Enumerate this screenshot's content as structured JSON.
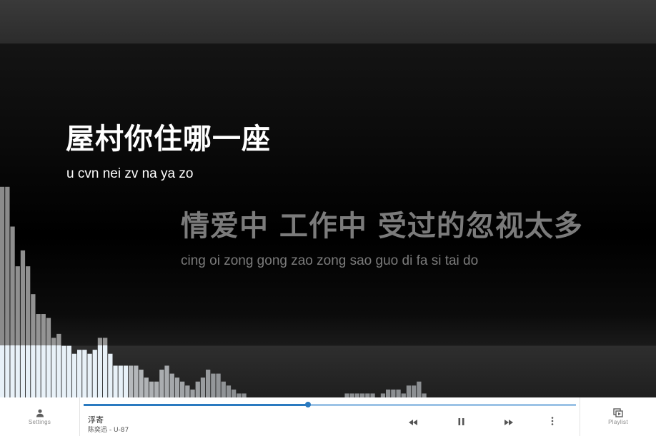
{
  "lyrics": {
    "current": {
      "text": "屋村你住哪一座",
      "romanization": "u cvn nei zv na ya zo"
    },
    "next": {
      "text": "情爱中 工作中 受过的忽视太多",
      "romanization": "cing oi zong gong zao zong sao guo di fa si tai do"
    }
  },
  "visualizer": {
    "levels": [
      0.53,
      0.53,
      0.43,
      0.33,
      0.37,
      0.33,
      0.26,
      0.21,
      0.21,
      0.2,
      0.15,
      0.16,
      0.13,
      0.13,
      0.11,
      0.12,
      0.12,
      0.11,
      0.12,
      0.15,
      0.15,
      0.11,
      0.08,
      0.08,
      0.08,
      0.08,
      0.08,
      0.07,
      0.05,
      0.04,
      0.04,
      0.07,
      0.08,
      0.06,
      0.05,
      0.04,
      0.03,
      0.02,
      0.04,
      0.05,
      0.07,
      0.06,
      0.06,
      0.04,
      0.03,
      0.02,
      0.01,
      0.01,
      0.0,
      0.0,
      0.0,
      0.0,
      0.0,
      0.0,
      0.0,
      0.0,
      0.0,
      0.0,
      0.0,
      0.0,
      0.0,
      0.0,
      0.0,
      0.0,
      0.0,
      0.0,
      0.0,
      0.01,
      0.01,
      0.01,
      0.01,
      0.01,
      0.01,
      0.0,
      0.01,
      0.02,
      0.02,
      0.02,
      0.01,
      0.03,
      0.03,
      0.04,
      0.01,
      0.0,
      0.0,
      0.0,
      0.0,
      0.0
    ],
    "bar_color_light": "#e8f1f8",
    "bar_color_dark": "#8a8a8a"
  },
  "player": {
    "title": "浮寄",
    "artist_album": "陈奕迅 - U-87",
    "progress": 0.456,
    "accent_color": "#2a7ac0",
    "track_color": "#9cc3e6"
  },
  "nav": {
    "settings_label": "Settings",
    "settings_icon": "person-icon",
    "playlist_label": "Playlist",
    "playlist_icon": "playlist-icon"
  },
  "controls": {
    "rewind_icon": "rewind-icon",
    "pause_icon": "pause-icon",
    "forward_icon": "fast-forward-icon",
    "more_icon": "more-vertical-icon"
  }
}
